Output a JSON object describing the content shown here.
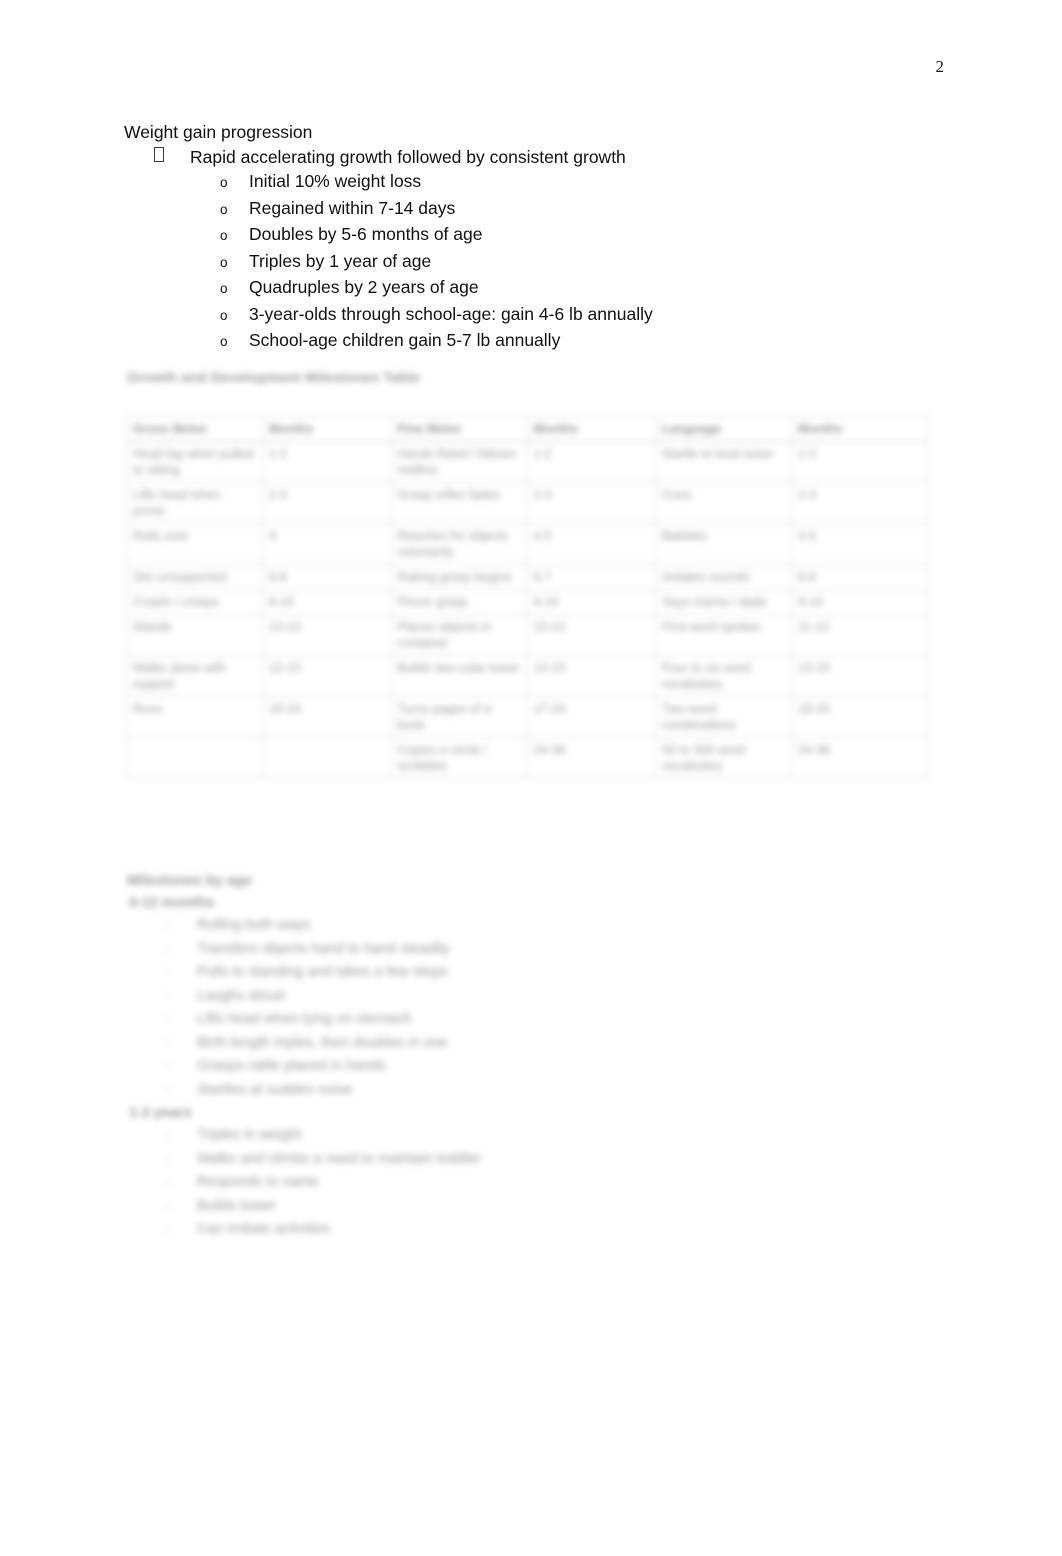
{
  "document": {
    "page_number": "2",
    "outline": {
      "heading": "Weight gain progression",
      "level1": {
        "bullet_glyph": "missing-glyph-box",
        "text": "Rapid accelerating growth followed by consistent growth"
      },
      "level2_bullet_glyph": "o",
      "level2_items": [
        "Initial 10% weight loss",
        "Regained within 7-14 days",
        "Doubles by 5-6 months of age",
        "Triples by 1 year of age",
        "Quadruples by 2 years of age",
        "3-year-olds through school-age: gain 4-6 lb annually",
        "School-age children gain 5-7 lb annually"
      ]
    },
    "redacted_table": {
      "caption": "Growth and Development Milestones Table",
      "note": "illegible - blurred in source image",
      "headers": [
        "Gross Motor",
        "Months",
        "Fine Motor",
        "Months",
        "Language",
        "Months"
      ],
      "rows": [
        [
          "Head lag when pulled to sitting",
          "1-2",
          "Hands fisted / follows midline",
          "1-2",
          "Startle to loud noise",
          "1-2"
        ],
        [
          "Lifts head when prone",
          "2-3",
          "Grasp reflex fades",
          "2-3",
          "Coos",
          "2-3"
        ],
        [
          "Rolls over",
          "4",
          "Reaches for objects voluntarily",
          "4-5",
          "Babbles",
          "4-6"
        ],
        [
          "Sits unsupported",
          "6-8",
          "Raking grasp begins",
          "6-7",
          "Imitates sounds",
          "6-8"
        ],
        [
          "Crawls / creeps",
          "8-10",
          "Pincer grasp",
          "9-10",
          "Says mama / dada",
          "9-10"
        ],
        [
          "Stands",
          "10-12",
          "Places objects in container",
          "10-12",
          "First word spoken",
          "11-12"
        ],
        [
          "Walks alone with support",
          "12-15",
          "Builds two-cube tower",
          "14-15",
          "Four to six word vocabulary",
          "13-15"
        ],
        [
          "Runs",
          "18-24",
          "Turns pages of a book",
          "17-24",
          "Two-word combinations",
          "18-24"
        ],
        [
          "",
          "",
          "Copies a circle / scribbles",
          "24-36",
          "50 to 300 word vocabulary",
          "24-36"
        ]
      ]
    },
    "redacted_lower": {
      "heading": "Milestones by age",
      "note": "illegible - blurred in source image",
      "sections": [
        {
          "label": "0-12 months",
          "items": [
            "Rolling both ways",
            "Transfers objects hand to hand steadily",
            "Pulls to standing and takes a few steps",
            "Laughs aloud",
            "Lifts head when lying on stomach",
            "Birth length triples, then doubles in one",
            "Grasps rattle placed in hands",
            "Startles at sudden noise"
          ]
        },
        {
          "label": "1-3 years",
          "items": [
            "Triples in weight",
            "Walks and climbs a need to maintain toddler",
            "Responds to name",
            "Builds tower",
            "Can imitate activities"
          ]
        }
      ]
    }
  }
}
